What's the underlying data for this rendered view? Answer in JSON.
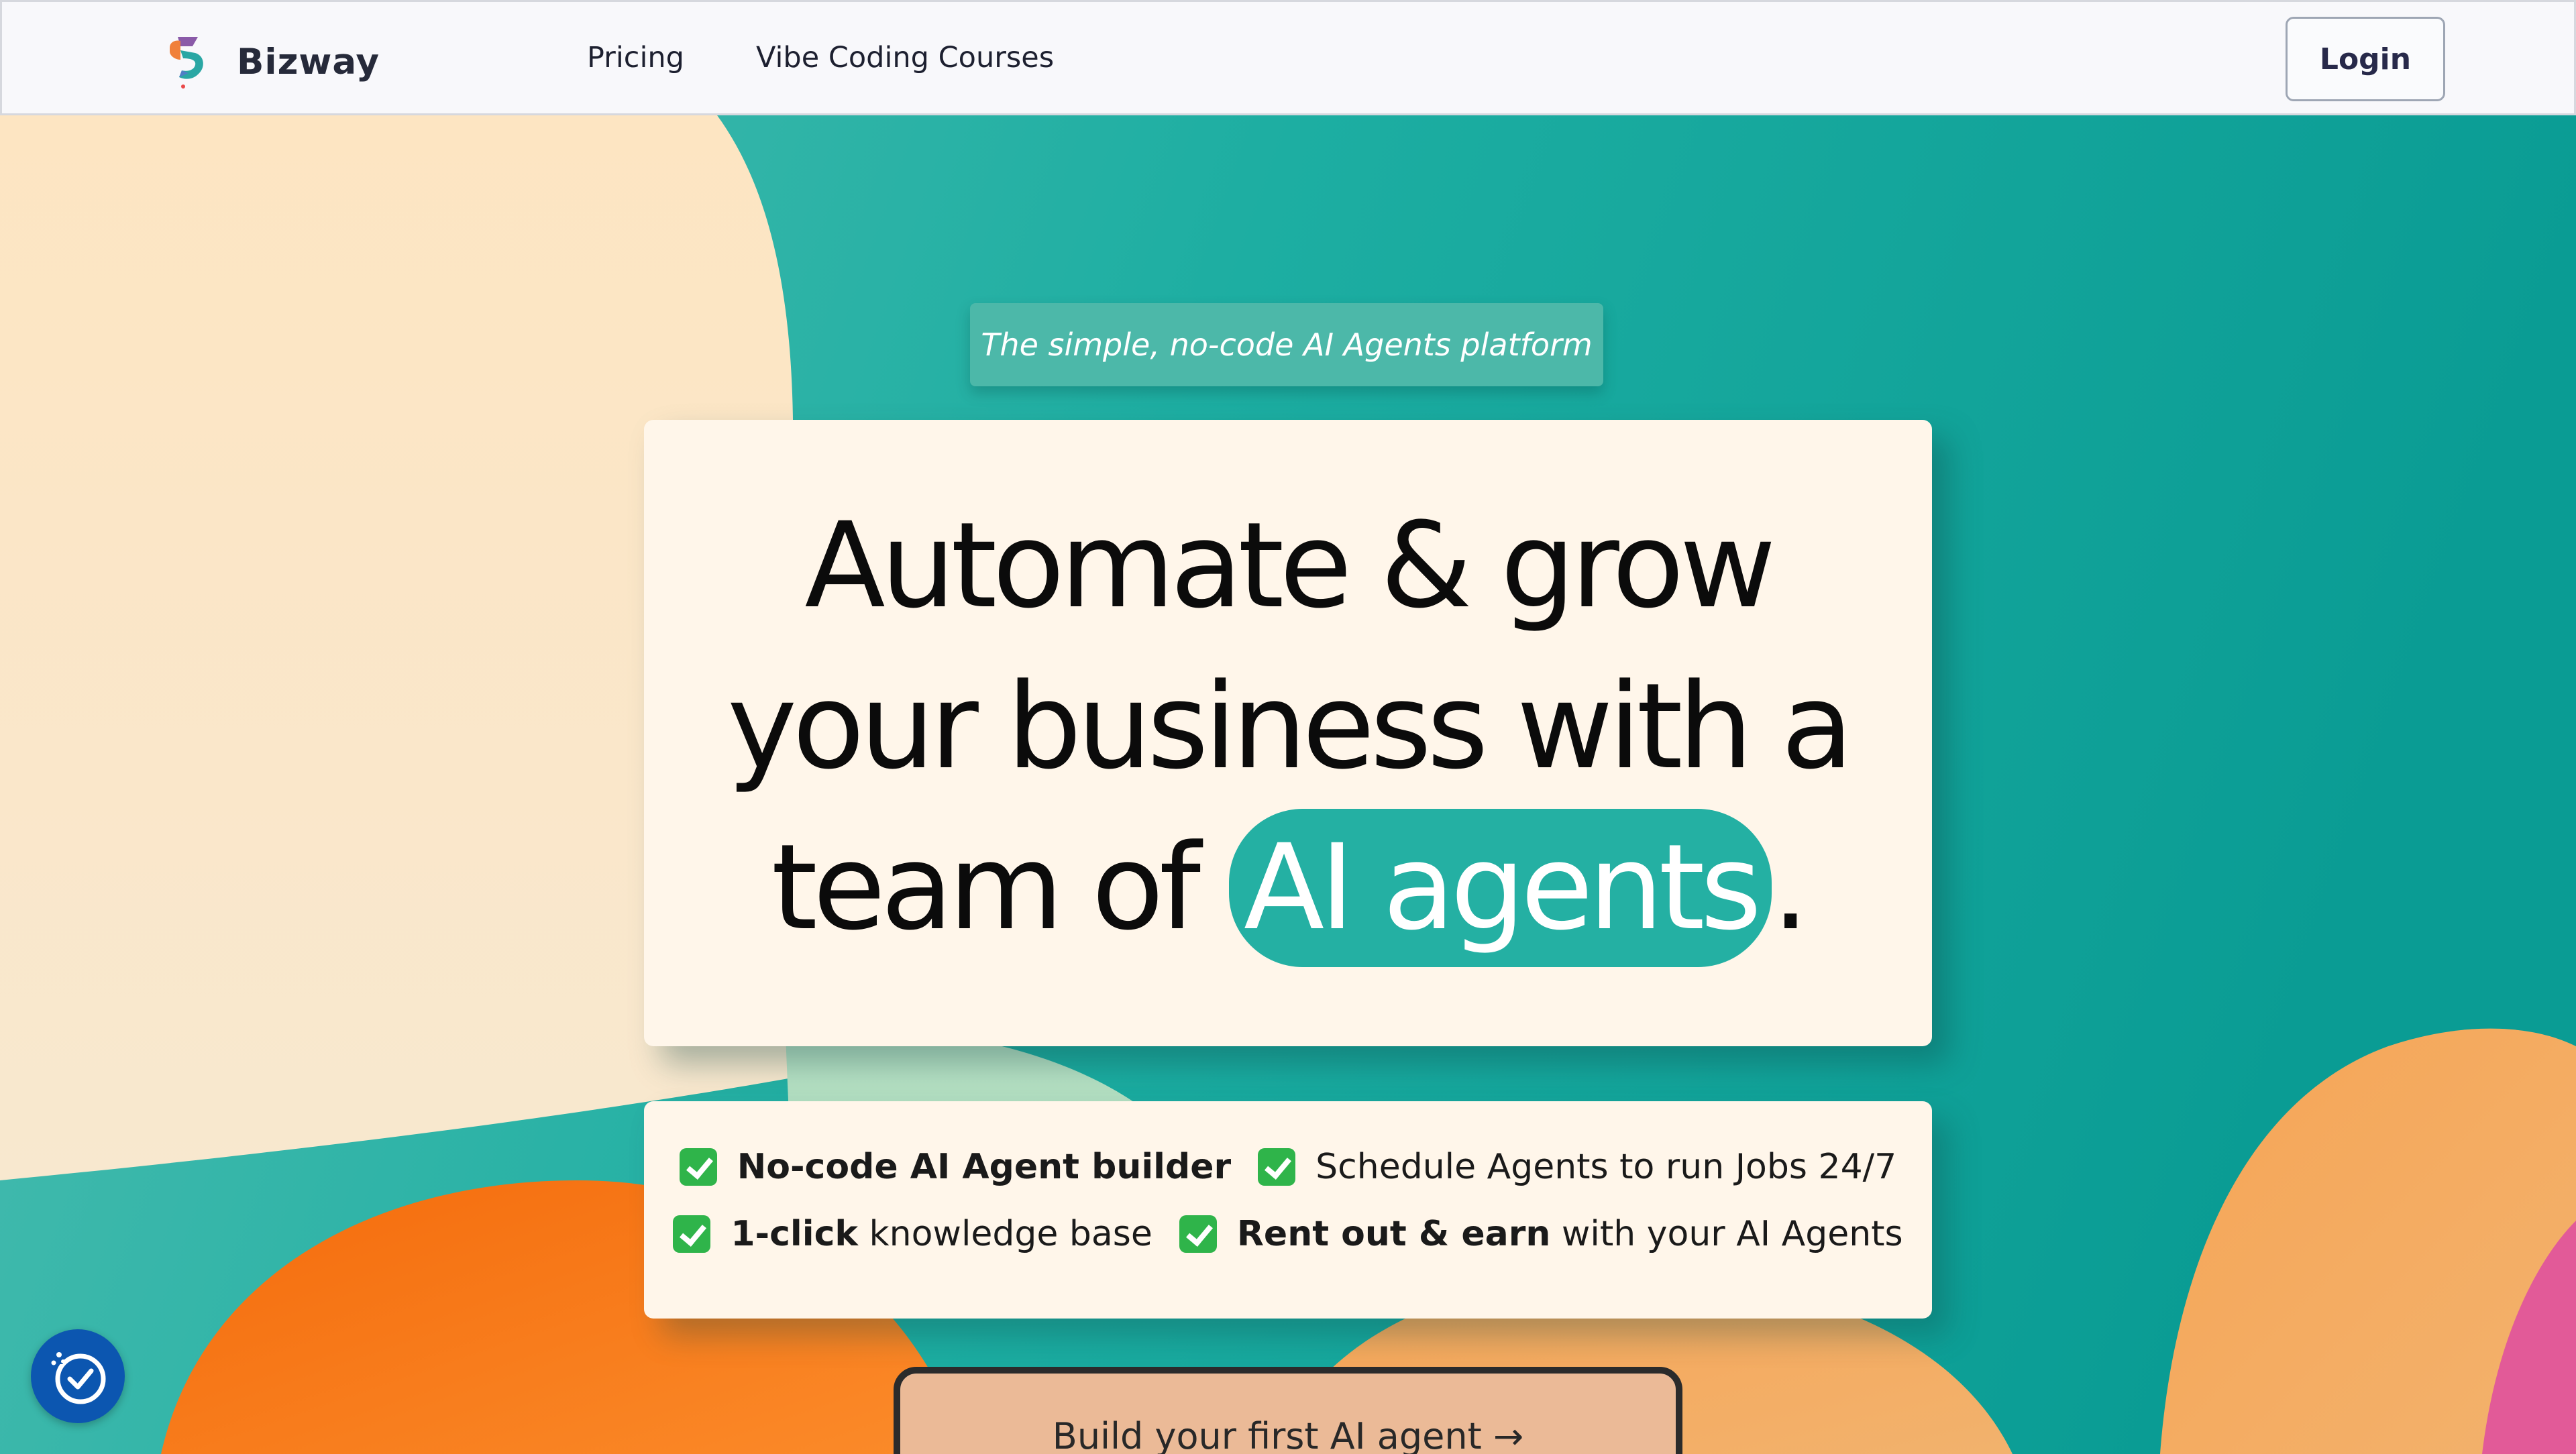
{
  "header": {
    "brand_name": "Bizway",
    "nav": [
      {
        "label": "Pricing"
      },
      {
        "label": "Vibe Coding Courses"
      }
    ],
    "login_label": "Login"
  },
  "hero": {
    "tagline": "The simple, no-code AI Agents platform",
    "title_line1": "Automate & grow",
    "title_line2": "your business with a",
    "title_line3_prefix": "team of ",
    "title_highlight": "AI agents",
    "title_suffix": "."
  },
  "features": [
    {
      "bold": "No-code AI Agent builder",
      "rest": ""
    },
    {
      "bold": "",
      "rest": "Schedule Agents to run Jobs 24/7"
    },
    {
      "bold": "1-click",
      "rest": " knowledge base"
    },
    {
      "bold": "Rent out & earn",
      "rest": " with your AI Agents"
    }
  ],
  "cta": {
    "label": "Build your first AI agent →"
  },
  "colors": {
    "teal": "#24b0a3",
    "cream": "#fff6ea",
    "orange": "#f87f18",
    "peach": "#f5ac5e",
    "pink": "#e25a98",
    "accessibility_blue": "#0c56b0"
  },
  "icons": {
    "logo": "bizway-logo-icon",
    "feature_check": "checkmark-icon",
    "accessibility": "accessibility-icon"
  }
}
